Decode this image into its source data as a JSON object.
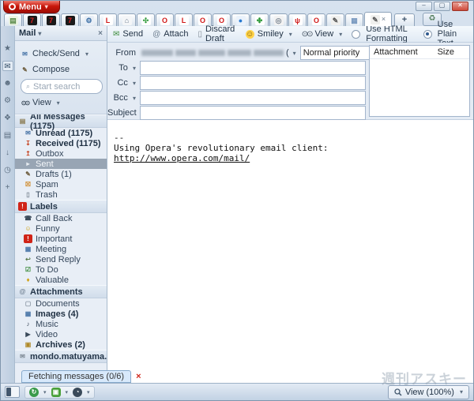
{
  "colors": {
    "accent_red": "#c8201a",
    "selection_gray": "#98a5b4",
    "chrome_blue": "#c2d2e4"
  },
  "menu": {
    "label": "Menu"
  },
  "window_controls": {
    "minimize": "–",
    "maximize": "▢",
    "close": "✕"
  },
  "tabs": {
    "new_tab_label": "+",
    "trash_glyph": "♻",
    "items": [
      {
        "name": "notes-doc",
        "glyph": "▤",
        "fg": "#5a8a4a",
        "bg": "#edf4e4"
      },
      {
        "name": "seven-site",
        "glyph": "7",
        "fg": "#e02020",
        "bg": "#1a1a1a"
      },
      {
        "name": "seven-site",
        "glyph": "7",
        "fg": "#e02020",
        "bg": "#1a1a1a"
      },
      {
        "name": "seven-site",
        "glyph": "7",
        "fg": "#e02020",
        "bg": "#1a1a1a"
      },
      {
        "name": "gear-site",
        "glyph": "⚙",
        "fg": "#3a6ea5",
        "bg": "#e8eef6"
      },
      {
        "name": "opera-mail",
        "glyph": "L",
        "fg": "#d01818",
        "bg": "#ffffff"
      },
      {
        "name": "home-site",
        "glyph": "⌂",
        "fg": "#6b7c8e",
        "bg": "#f4f6f8"
      },
      {
        "name": "pinwheel-site",
        "glyph": "✣",
        "fg": "#2f9a3a",
        "bg": "#ffffff"
      },
      {
        "name": "opera-o",
        "glyph": "O",
        "fg": "#d01818",
        "bg": "#ffffff"
      },
      {
        "name": "opera-mail",
        "glyph": "L",
        "fg": "#d01818",
        "bg": "#ffffff"
      },
      {
        "name": "opera-o",
        "glyph": "O",
        "fg": "#d01818",
        "bg": "#ffffff"
      },
      {
        "name": "opera-o",
        "glyph": "O",
        "fg": "#d01818",
        "bg": "#ffffff"
      },
      {
        "name": "globe-site",
        "glyph": "●",
        "fg": "#2a7ad0",
        "bg": "#eaf2fb"
      },
      {
        "name": "clover-site",
        "glyph": "✤",
        "fg": "#2f9a3a",
        "bg": "#ffffff"
      },
      {
        "name": "badge-site",
        "glyph": "◎",
        "fg": "#7d8894",
        "bg": "#f2f2f2"
      },
      {
        "name": "antenna-site",
        "glyph": "ψ",
        "fg": "#d02020",
        "bg": "#ffffff"
      },
      {
        "name": "opera-o",
        "glyph": "O",
        "fg": "#d01818",
        "bg": "#ffffff"
      },
      {
        "name": "pencil-compose",
        "glyph": "✎",
        "fg": "#555555",
        "bg": "#f0f0ee"
      },
      {
        "name": "image-site",
        "glyph": "▦",
        "fg": "#7a9ac0",
        "bg": "#f2f5f9"
      },
      {
        "name": "compose-active",
        "glyph": "✎",
        "fg": "#555555",
        "bg": "#f0f0ee",
        "active": true,
        "close": "×"
      }
    ]
  },
  "panel_strip": {
    "items": [
      {
        "name": "bookmarks",
        "glyph": "★"
      },
      {
        "name": "mail",
        "glyph": "✉",
        "active": true
      },
      {
        "name": "contacts",
        "glyph": "☻"
      },
      {
        "name": "widgets",
        "glyph": "⚙"
      },
      {
        "name": "unite",
        "glyph": "❖"
      },
      {
        "name": "notes",
        "glyph": "▤"
      },
      {
        "name": "transfers",
        "glyph": "↓"
      },
      {
        "name": "history",
        "glyph": "◷"
      },
      {
        "name": "add-panel",
        "glyph": "+"
      }
    ]
  },
  "sidebar": {
    "title": "Mail",
    "close_glyph": "×",
    "check_send": "Check/Send",
    "compose": "Compose",
    "search_placeholder": "Start search",
    "view": "View",
    "sections": [
      {
        "header": "All Messages (1175)",
        "icon": "▤",
        "icon_color": "#8a7a50",
        "items": [
          {
            "label": "Unread (1175)",
            "icon": "✉",
            "color": "#4a76a8",
            "bold": true
          },
          {
            "label": "Received (1175)",
            "icon": "↧",
            "color": "#c84a2a",
            "bold": true
          },
          {
            "label": "Outbox",
            "icon": "↥",
            "color": "#c84a2a"
          },
          {
            "label": "Sent",
            "icon": "▸",
            "color": "#e8edf2",
            "selected": true
          },
          {
            "label": "Drafts (1)",
            "icon": "✎",
            "color": "#6b5a3a"
          },
          {
            "label": "Spam",
            "icon": "☒",
            "color": "#d08a2a"
          },
          {
            "label": "Trash",
            "icon": "▯",
            "color": "#7d8894"
          }
        ]
      },
      {
        "header": "Labels",
        "icon": "!",
        "icon_color": "#ffffff",
        "icon_bg": "#d02418",
        "items": [
          {
            "label": "Call Back",
            "icon": "☎",
            "color": "#3a4a5a"
          },
          {
            "label": "Funny",
            "icon": "☺",
            "color": "#d0a010"
          },
          {
            "label": "Important",
            "icon": "!",
            "color": "#ffffff",
            "bg": "#d02418"
          },
          {
            "label": "Meeting",
            "icon": "▦",
            "color": "#4a76a8"
          },
          {
            "label": "Send Reply",
            "icon": "↩",
            "color": "#5a7a4a"
          },
          {
            "label": "To Do",
            "icon": "☑",
            "color": "#3a8a3a"
          },
          {
            "label": "Valuable",
            "icon": "♦",
            "color": "#d0a010"
          }
        ]
      },
      {
        "header": "Attachments",
        "icon": "@",
        "icon_color": "#6b7c8e",
        "items": [
          {
            "label": "Documents",
            "icon": "▢",
            "color": "#8a96a3"
          },
          {
            "label": "Images (4)",
            "icon": "▦",
            "color": "#4a76a8",
            "bold": true
          },
          {
            "label": "Music",
            "icon": "♪",
            "color": "#3a4a5a"
          },
          {
            "label": "Video",
            "icon": "▶",
            "color": "#3a4a5a"
          },
          {
            "label": "Archives (2)",
            "icon": "▣",
            "color": "#b08a2a",
            "bold": true
          }
        ]
      },
      {
        "header": "mondo.matuyama...",
        "icon": "✉",
        "icon_color": "#7d8894",
        "items": []
      }
    ]
  },
  "composer": {
    "toolbar": {
      "send": "Send",
      "attach": "Attach",
      "discard": "Discard Draft",
      "smiley": "Smiley",
      "view": "View"
    },
    "format": {
      "html_label": "Use HTML Formatting",
      "plain_label": "Use Plain Text",
      "selected": "plain"
    },
    "fields": {
      "from_label": "From",
      "to_label": "To",
      "cc_label": "Cc",
      "bcc_label": "Bcc",
      "subject_label": "Subject",
      "from_suffix": "(",
      "priority": "Normal priority",
      "to_value": "",
      "cc_value": "",
      "bcc_value": "",
      "subject_value": ""
    },
    "attach_panel": {
      "col_attachment": "Attachment",
      "col_size": "Size"
    },
    "body": {
      "sig_dashes": "--",
      "sig_text": "Using Opera's revolutionary email client: ",
      "sig_url": "http://www.opera.com/mail/"
    }
  },
  "status": {
    "fetching": "Fetching messages (0/6)",
    "close_glyph": "×",
    "view_zoom": "View (100%)"
  },
  "watermark": {
    "text": "週刊アスキー"
  }
}
